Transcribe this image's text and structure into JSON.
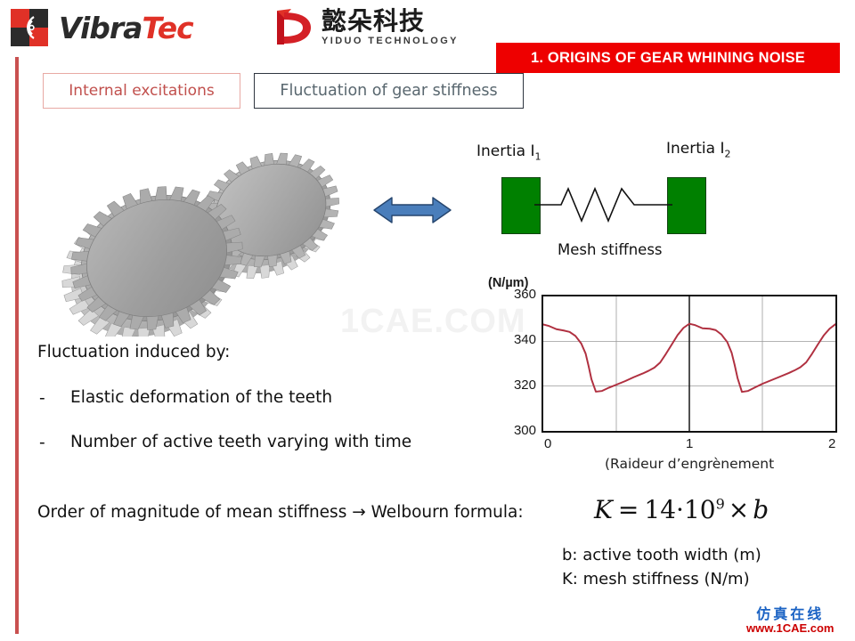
{
  "header": {
    "vibratec": {
      "part1": "Vibra",
      "part2": "Tec",
      "mark_icon": "radar-waves-icon"
    },
    "yiduo": {
      "cn_name": "懿朵科技",
      "en_name": "YIDUO TECHNOLOGY",
      "mark_icon": "yiduo-d-icon"
    },
    "section_banner": "1. ORIGINS OF GEAR WHINING NOISE",
    "banner_color": "#ee0000"
  },
  "crumbs": {
    "internal": {
      "label": "Internal  excitations",
      "text_color": "#c1504d",
      "border_color": "#e8a9a4"
    },
    "fluctuation": {
      "label": "Fluctuation  of gear stiffness",
      "text_color": "#59676f",
      "border_color": "#2f3640"
    }
  },
  "illustration": {
    "gear_icon": "meshing-gears-icon",
    "arrow_icon": "double-headed-arrow-icon",
    "arrow_color": "#4a7ebb"
  },
  "lumped_model": {
    "inertia_1": "Inertia I",
    "inertia_1_sub": "1",
    "inertia_2": "Inertia I",
    "inertia_2_sub": "2",
    "spring_label": "Mesh stiffness",
    "mass_color": "#008000",
    "spring_icon": "coil-spring-icon"
  },
  "body": {
    "intro": "Fluctuation  induced  by:",
    "bullet_dash": "-",
    "bullet_1": "Elastic  deformation  of  the  teeth",
    "bullet_2": "Number  of active  teeth  varying with  time",
    "welbourn_line": "Order of magnitude of mean  stiffness  → Welbourn  formula:"
  },
  "formula": {
    "lhs": "K",
    "equals": "=",
    "coefficient": "14",
    "dot": "·",
    "base": "10",
    "exponent": "9",
    "times": "×",
    "variable": "b",
    "legend_b": "b: active tooth  width  (m)",
    "legend_k": "K: mesh  stiffness  (N/m)"
  },
  "watermarks": {
    "center": "1CAE.COM",
    "corner_cn": "仿真在线",
    "corner_url": "www.1CAE.com"
  },
  "chart_data": {
    "type": "line",
    "title": "",
    "xlabel": "(Raideur d’engrènement",
    "ylabel": "(N/µm)",
    "unit_label": "(N/µm)",
    "xlim": [
      0,
      2
    ],
    "ylim": [
      300,
      360
    ],
    "xticks": [
      "0",
      "1",
      "2"
    ],
    "xtick_values": [
      0,
      1,
      2
    ],
    "yticks": [
      "360",
      "340",
      "320",
      "300"
    ],
    "ytick_values": [
      360,
      340,
      320,
      300
    ],
    "grid": true,
    "gridlines_y": [
      340,
      320
    ],
    "gridlines_x": [
      0.5,
      1.0,
      1.5
    ],
    "line_color": "#b03040",
    "series": [
      {
        "name": "mesh stiffness",
        "x": [
          0.0,
          0.04,
          0.09,
          0.14,
          0.18,
          0.22,
          0.26,
          0.29,
          0.31,
          0.33,
          0.36,
          0.4,
          0.45,
          0.5,
          0.56,
          0.62,
          0.68,
          0.72,
          0.76,
          0.8,
          0.84,
          0.88,
          0.92,
          0.96,
          1.0,
          1.04,
          1.09,
          1.14,
          1.18,
          1.22,
          1.26,
          1.29,
          1.31,
          1.33,
          1.36,
          1.4,
          1.45,
          1.5,
          1.56,
          1.62,
          1.68,
          1.72,
          1.76,
          1.8,
          1.84,
          1.88,
          1.92,
          1.96,
          2.0
        ],
        "y": [
          347.5,
          346.8,
          345.4,
          344.8,
          344.2,
          342.4,
          339.0,
          334.5,
          329.0,
          323.0,
          317.5,
          317.8,
          319.3,
          320.6,
          322.2,
          324.0,
          325.6,
          326.8,
          328.2,
          330.5,
          334.4,
          338.6,
          342.8,
          346.0,
          347.8,
          347.2,
          345.8,
          345.6,
          345.0,
          343.0,
          339.6,
          334.8,
          329.5,
          323.6,
          317.4,
          317.8,
          319.4,
          321.0,
          322.6,
          324.2,
          325.8,
          327.0,
          328.4,
          330.6,
          334.4,
          338.6,
          342.6,
          345.6,
          347.6
        ]
      }
    ]
  }
}
